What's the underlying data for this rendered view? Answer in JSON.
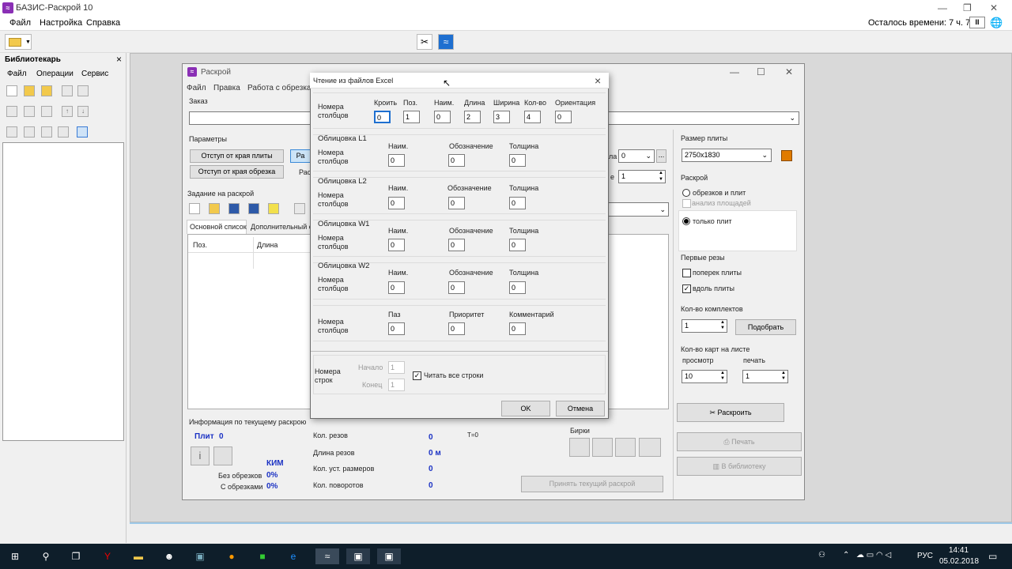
{
  "app": {
    "title": "БАЗИС-Раскрой 10",
    "menu": [
      "Файл",
      "Настройка",
      "Справка"
    ],
    "time_left": "Осталось времени: 7 ч. 7 м."
  },
  "library": {
    "title": "Библиотекарь",
    "close": "×",
    "menu": [
      "Файл",
      "Операции",
      "Сервис"
    ]
  },
  "raskroy": {
    "title": "Раскрой",
    "menu": [
      "Файл",
      "Правка",
      "Работа с обрезками"
    ],
    "order_label": "Заказ",
    "params_label": "Параметры",
    "btn_edge_plate": "Отступ от края плиты",
    "btn_edge_scrap": "Отступ от края обрезка",
    "btn_ra": "Ра",
    "lbl_ras": "Рас",
    "lbl_la": "ла",
    "lbl_e": "е",
    "combo_value": "0",
    "spin_value": "1",
    "task_label": "Задание на раскрой",
    "tabs": [
      "Основной список",
      "Дополнительный с"
    ],
    "columns": [
      "Поз.",
      "Длина"
    ],
    "plate_size_label": "Размер плиты",
    "plate_size_value": "2750x1830",
    "raskroy_label": "Раскрой",
    "radio_scraps": "обрезков и плит",
    "check_area": "анализ площадей",
    "radio_plates": "только плит",
    "first_cuts_label": "Первые резы",
    "check_across": "поперек плиты",
    "check_along": "вдоль плиты",
    "kits_label": "Кол-во комплектов",
    "kits_value": "1",
    "btn_select": "Подобрать",
    "maps_label": "Кол-во карт на листе",
    "preview_label": "просмотр",
    "print_label": "печать",
    "preview_value": "10",
    "print_value": "1",
    "btn_cut": "Раскроить",
    "btn_print": "Печать",
    "btn_library": "В библиотеку",
    "info_label": "Информация по текущему раскрою",
    "plates_label": "Плит",
    "plates_value": "0",
    "kim_label": "КИМ",
    "no_scraps_label": "Без обрезков",
    "no_scraps_value": "0%",
    "with_scraps_label": "С обрезками",
    "with_scraps_value": "0%",
    "cuts_label": "Кол. резов",
    "cuts_value": "0",
    "cut_len_label": "Длина резов",
    "cut_len_value": "0 м",
    "sizes_label": "Кол. уст. размеров",
    "sizes_value": "0",
    "turns_label": "Кол. поворотов",
    "turns_value": "0",
    "t_label": "T=0",
    "tags_label": "Бирки",
    "btn_accept": "Принять текущий раскрой"
  },
  "dialog": {
    "title": "Чтение из файлов Excel",
    "close": "×",
    "col_numbers": "Номера столбцов",
    "main_headers": [
      "Кроить",
      "Поз.",
      "Наим.",
      "Длина",
      "Ширина",
      "Кол-во",
      "Ориентация"
    ],
    "main_values": [
      "0",
      "1",
      "0",
      "2",
      "3",
      "4",
      "0"
    ],
    "facings": [
      {
        "title": "Облицовка L1",
        "values": [
          "0",
          "0",
          "0"
        ]
      },
      {
        "title": "Облицовка L2",
        "values": [
          "0",
          "0",
          "0"
        ]
      },
      {
        "title": "Облицовка W1",
        "values": [
          "0",
          "0",
          "0"
        ]
      },
      {
        "title": "Облицовка W2",
        "values": [
          "0",
          "0",
          "0"
        ]
      }
    ],
    "facing_headers": [
      "Наим.",
      "Обозначение",
      "Толщина"
    ],
    "extra_headers": [
      "Паз",
      "Приоритет",
      "Комментарий"
    ],
    "extra_values": [
      "0",
      "0",
      "0"
    ],
    "row_numbers": "Номера строк",
    "start_label": "Начало",
    "start_value": "1",
    "end_label": "Конец",
    "end_value": "1",
    "read_all": "Читать все строки",
    "ok": "OK",
    "cancel": "Отмена"
  },
  "taskbar": {
    "lang": "РУС",
    "time": "14:41",
    "date": "05.02.2018"
  }
}
